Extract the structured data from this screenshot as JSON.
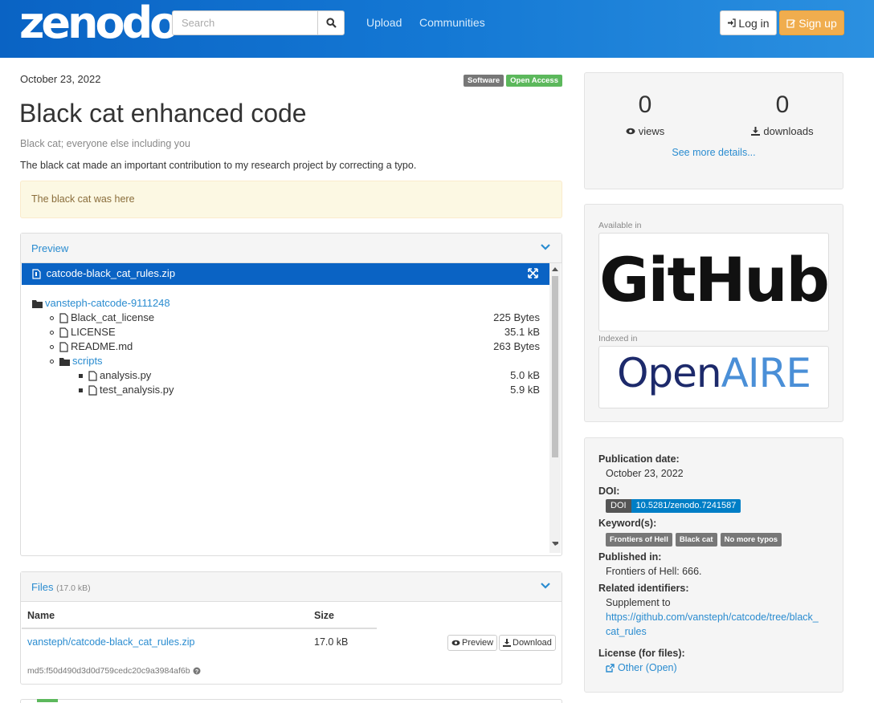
{
  "header": {
    "logo": "zenodo",
    "search_placeholder": "Search",
    "nav": [
      "Upload",
      "Communities"
    ],
    "login": "Log in",
    "signup": "Sign up"
  },
  "record": {
    "date": "October 23, 2022",
    "badges": [
      "Software",
      "Open Access"
    ],
    "title": "Black cat enhanced code",
    "creators": "Black cat; everyone else including you",
    "description": "The black cat made an important contribution to my research project by correcting a typo.",
    "notice": "The black cat was here"
  },
  "preview": {
    "heading": "Preview",
    "filename": "catcode-black_cat_rules.zip",
    "root": "vansteph-catcode-9111248",
    "files": [
      {
        "name": "Black_cat_license",
        "size": "225 Bytes"
      },
      {
        "name": "LICENSE",
        "size": "35.1 kB"
      },
      {
        "name": "README.md",
        "size": "263 Bytes"
      }
    ],
    "folder": "scripts",
    "subfiles": [
      {
        "name": "analysis.py",
        "size": "5.0 kB"
      },
      {
        "name": "test_analysis.py",
        "size": "5.9 kB"
      }
    ]
  },
  "files": {
    "heading": "Files",
    "total": "(17.0 kB)",
    "col_name": "Name",
    "col_size": "Size",
    "file_name": "vansteph/catcode-black_cat_rules.zip",
    "file_size": "17.0 kB",
    "preview_btn": "Preview",
    "download_btn": "Download",
    "md5": "md5:f50d490d3d0d759cedc20c9a3984af6b"
  },
  "stats": {
    "views": "0",
    "views_label": "views",
    "downloads": "0",
    "downloads_label": "downloads",
    "more": "See more details..."
  },
  "available": {
    "available_label": "Available in",
    "github": "GitHub",
    "indexed_label": "Indexed in",
    "openaire_a": "Open",
    "openaire_b": "AIRE"
  },
  "meta": {
    "pub_date_label": "Publication date:",
    "pub_date": "October 23, 2022",
    "doi_label": "DOI:",
    "doi_prefix": "DOI",
    "doi": "10.5281/zenodo.7241587",
    "keywords_label": "Keyword(s):",
    "keywords": [
      "Frontiers of Hell",
      "Black cat",
      "No more typos"
    ],
    "published_in_label": "Published in:",
    "published_in": "Frontiers of Hell: 666.",
    "related_label": "Related identifiers:",
    "related_type": "Supplement to",
    "related_url_1": "https://github.com/vansteph/catcode/tree/black_",
    "related_url_2": "cat_rules",
    "license_label": "License (for files):",
    "license": "Other (Open)"
  },
  "colors": {
    "navbar": "#0a63c4",
    "link": "#2a8cd0",
    "signup": "#f0ad4e",
    "open_access": "#5cb85c",
    "doi": "#007ec6"
  }
}
